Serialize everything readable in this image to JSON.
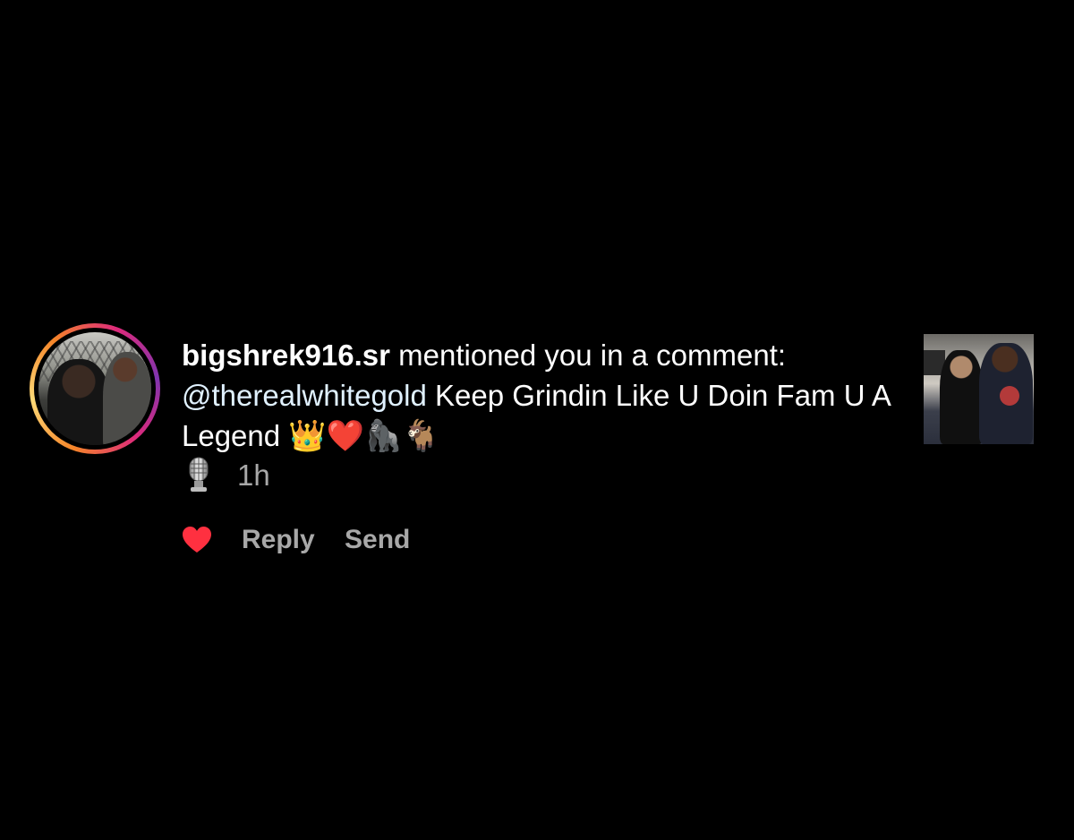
{
  "notification": {
    "username": "bigshrek916.sr",
    "action_text": " mentioned you in a comment: ",
    "mention": "@therealwhitegold",
    "comment_text": " Keep Grindin Like U Doin Fam U A Legend ",
    "emojis": "👑❤️🦍🐐",
    "timestamp": "1h",
    "actions": {
      "reply_label": "Reply",
      "send_label": "Send"
    }
  },
  "icons": {
    "like": "heart-icon",
    "microphone": "microphone-icon"
  },
  "colors": {
    "background": "#000000",
    "text": "#ffffff",
    "secondary_text": "#a8a8a8",
    "mention": "#e0f1ff",
    "like": "#ff3040"
  }
}
